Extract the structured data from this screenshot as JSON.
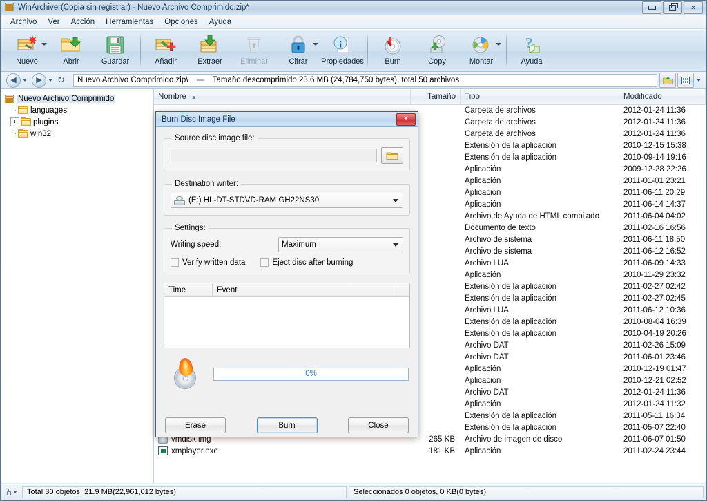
{
  "window": {
    "title": "WinArchiver(Copia sin registrar) - Nuevo Archivo Comprimido.zip*",
    "icon": "archive-icon",
    "minimize_label": "Minimizar",
    "restore_label": "Restaurar",
    "close_label": "Cerrar"
  },
  "menu": [
    {
      "label": "Archivo"
    },
    {
      "label": "Ver"
    },
    {
      "label": "Acción"
    },
    {
      "label": "Herramientas"
    },
    {
      "label": "Opciones"
    },
    {
      "label": "Ayuda"
    }
  ],
  "toolbar": [
    {
      "label": "Nuevo",
      "icon": "new-archive-icon",
      "dropdown": true,
      "disabled": false
    },
    {
      "label": "Abrir",
      "icon": "open-folder-icon",
      "dropdown": false,
      "disabled": false
    },
    {
      "label": "Guardar",
      "icon": "save-floppy-icon",
      "dropdown": false,
      "disabled": false
    },
    {
      "label": "Añadir",
      "icon": "add-files-icon",
      "dropdown": false,
      "disabled": false
    },
    {
      "label": "Extraer",
      "icon": "extract-icon",
      "dropdown": false,
      "disabled": false
    },
    {
      "label": "Eliminar",
      "icon": "delete-trash-icon",
      "dropdown": false,
      "disabled": true
    },
    {
      "label": "Cifrar",
      "icon": "lock-encrypt-icon",
      "dropdown": true,
      "disabled": false
    },
    {
      "label": "Propiedades",
      "icon": "info-properties-icon",
      "dropdown": false,
      "disabled": false
    },
    {
      "label": "Burn",
      "icon": "burn-disc-icon",
      "dropdown": false,
      "disabled": false
    },
    {
      "label": "Copy",
      "icon": "copy-disc-icon",
      "dropdown": false,
      "disabled": false
    },
    {
      "label": "Montar",
      "icon": "mount-disc-icon",
      "dropdown": true,
      "disabled": false
    },
    {
      "label": "Ayuda",
      "icon": "help-question-icon",
      "dropdown": false,
      "disabled": false
    }
  ],
  "navbar": {
    "back_label": "Atrás",
    "forward_label": "Adelante",
    "refresh_label": "Actualizar",
    "path": "Nuevo Archivo Comprimido.zip\\",
    "separator": "----",
    "info": "Tamaño descomprimido 23.6 MB (24,784,750 bytes), total 50 archivos",
    "up_button": "up-folder-button",
    "view_button": "view-mode-button"
  },
  "tree": {
    "root": {
      "label": "Nuevo Archivo Comprimido",
      "icon": "archive-icon"
    },
    "children": [
      {
        "label": "languages",
        "icon": "folder-icon",
        "expandable": false
      },
      {
        "label": "plugins",
        "icon": "folder-icon",
        "expandable": true
      },
      {
        "label": "win32",
        "icon": "folder-icon",
        "expandable": false
      }
    ]
  },
  "filelist": {
    "columns": [
      {
        "label": "Nombre",
        "sort": "▲"
      },
      {
        "label": "Tamaño"
      },
      {
        "label": "Tipo"
      },
      {
        "label": "Modificado"
      }
    ],
    "rows": [
      {
        "name": "",
        "size": "",
        "type": "Carpeta de archivos",
        "modified": "2012-01-24 11:36",
        "icon": ""
      },
      {
        "name": "",
        "size": "",
        "type": "Carpeta de archivos",
        "modified": "2012-01-24 11:36",
        "icon": ""
      },
      {
        "name": "",
        "size": "",
        "type": "Carpeta de archivos",
        "modified": "2012-01-24 11:36",
        "icon": ""
      },
      {
        "name": "",
        "size": "",
        "type": "Extensión de la aplicación",
        "modified": "2010-12-15 15:38",
        "icon": ""
      },
      {
        "name": "",
        "size": "",
        "type": "Extensión de la aplicación",
        "modified": "2010-09-14 19:16",
        "icon": ""
      },
      {
        "name": "",
        "size": "",
        "type": "Aplicación",
        "modified": "2009-12-28 22:26",
        "icon": ""
      },
      {
        "name": "",
        "size": "",
        "type": "Aplicación",
        "modified": "2011-01-01 23:21",
        "icon": ""
      },
      {
        "name": "",
        "size": "",
        "type": "Aplicación",
        "modified": "2011-06-11 20:29",
        "icon": ""
      },
      {
        "name": "",
        "size": "",
        "type": "Aplicación",
        "modified": "2011-06-14 14:37",
        "icon": ""
      },
      {
        "name": "",
        "size": "",
        "type": "Archivo de Ayuda de HTML compilado",
        "modified": "2011-06-04 04:02",
        "icon": ""
      },
      {
        "name": "",
        "size": "",
        "type": "Documento de texto",
        "modified": "2011-02-16 16:56",
        "icon": ""
      },
      {
        "name": "",
        "size": "",
        "type": "Archivo de sistema",
        "modified": "2011-06-11 18:50",
        "icon": ""
      },
      {
        "name": "",
        "size": "",
        "type": "Archivo de sistema",
        "modified": "2011-06-12 16:52",
        "icon": ""
      },
      {
        "name": "",
        "size": "",
        "type": "Archivo LUA",
        "modified": "2011-06-09 14:33",
        "icon": ""
      },
      {
        "name": "",
        "size": "",
        "type": "Aplicación",
        "modified": "2010-11-29 23:32",
        "icon": ""
      },
      {
        "name": "",
        "size": "",
        "type": "Extensión de la aplicación",
        "modified": "2011-02-27 02:42",
        "icon": ""
      },
      {
        "name": "",
        "size": "",
        "type": "Extensión de la aplicación",
        "modified": "2011-02-27 02:45",
        "icon": ""
      },
      {
        "name": "",
        "size": "",
        "type": "Archivo LUA",
        "modified": "2011-06-12 10:36",
        "icon": ""
      },
      {
        "name": "",
        "size": "",
        "type": "Extensión de la aplicación",
        "modified": "2010-08-04 16:39",
        "icon": ""
      },
      {
        "name": "",
        "size": "",
        "type": "Extensión de la aplicación",
        "modified": "2010-04-19 20:26",
        "icon": ""
      },
      {
        "name": "",
        "size": "",
        "type": "Archivo DAT",
        "modified": "2011-02-26 15:09",
        "icon": ""
      },
      {
        "name": "",
        "size": "",
        "type": "Archivo DAT",
        "modified": "2011-06-01 23:46",
        "icon": ""
      },
      {
        "name": "",
        "size": "",
        "type": "Aplicación",
        "modified": "2010-12-19 01:47",
        "icon": ""
      },
      {
        "name": "",
        "size": "",
        "type": "Aplicación",
        "modified": "2010-12-21 02:52",
        "icon": ""
      },
      {
        "name": "",
        "size": "",
        "type": "Archivo DAT",
        "modified": "2012-01-24 11:36",
        "icon": ""
      },
      {
        "name": "",
        "size": "",
        "type": "Aplicación",
        "modified": "2012-01-24 11:32",
        "icon": ""
      },
      {
        "name": "",
        "size": "",
        "type": "Extensión de la aplicación",
        "modified": "2011-05-11 16:34",
        "icon": ""
      },
      {
        "name": "",
        "size": "",
        "type": "Extensión de la aplicación",
        "modified": "2011-05-07 22:40",
        "icon": ""
      },
      {
        "name": "vmdisk.img",
        "size": "265 KB",
        "type": "Archivo de imagen de disco",
        "modified": "2011-06-07 01:50",
        "icon": "disc-image-icon"
      },
      {
        "name": "xmplayer.exe",
        "size": "181 KB",
        "type": "Aplicación",
        "modified": "2011-02-24 23:44",
        "icon": "application-icon"
      }
    ]
  },
  "statusbar": {
    "total": "Total 30 objetos, 21.9 MB(22,961,012 bytes)",
    "selected": "Seleccionados 0 objetos, 0 KB(0 bytes)",
    "lock_icon": "lock-icon"
  },
  "dialog": {
    "title": "Burn Disc Image File",
    "close_label": "✕",
    "source": {
      "legend": "Source disc image file:",
      "value": "",
      "placeholder": "",
      "browse_icon": "folder-open-icon"
    },
    "destination": {
      "legend": "Destination writer:",
      "value": "(E:) HL-DT-STDVD-RAM GH22NS30",
      "icon": "optical-drive-icon"
    },
    "settings": {
      "legend": "Settings:",
      "speed_label": "Writing speed:",
      "speed_value": "Maximum",
      "verify_label": "Verify written data",
      "verify_checked": false,
      "eject_label": "Eject disc after burning",
      "eject_checked": false
    },
    "log": {
      "columns": [
        "Time",
        "Event"
      ],
      "rows": []
    },
    "progress": {
      "icon": "burning-disc-icon",
      "percent": "0%",
      "value": 0
    },
    "buttons": [
      {
        "label": "Erase",
        "default": false
      },
      {
        "label": "Burn",
        "default": true
      },
      {
        "label": "Close",
        "default": false
      }
    ]
  },
  "colors": {
    "accent": "#3c94d4",
    "title_text": "#14395c",
    "progress_text": "#2f78b5",
    "close_red": "#d94a4a"
  }
}
